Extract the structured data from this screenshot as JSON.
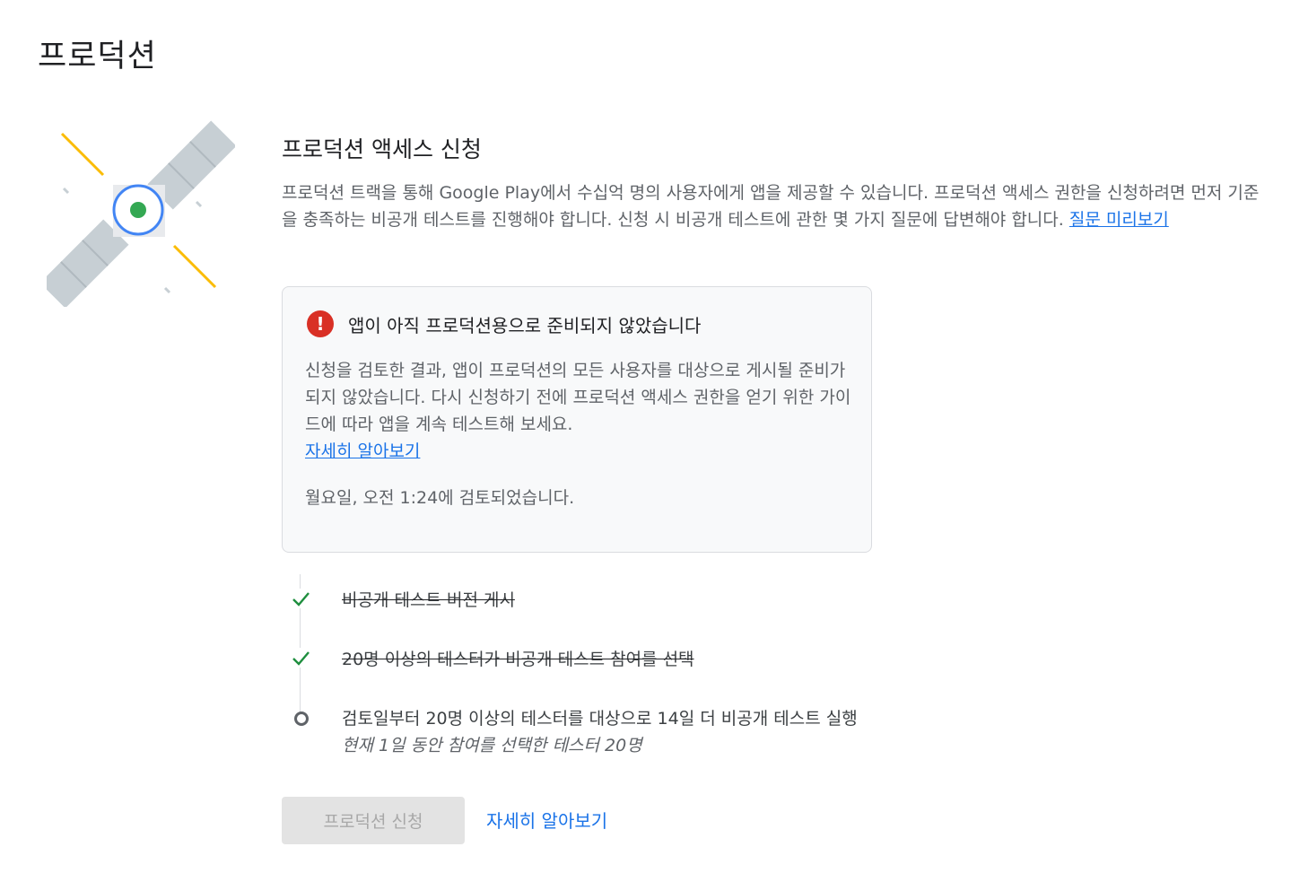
{
  "page": {
    "title": "프로덕션"
  },
  "section": {
    "title": "프로덕션 액세스 신청",
    "description": "프로덕션 트랙을 통해 Google Play에서 수십억 명의 사용자에게 앱을 제공할 수 있습니다. 프로덕션 액세스 권한을 신청하려면 먼저 기준을 충족하는 비공개 테스트를 진행해야 합니다. 신청 시 비공개 테스트에 관한 몇 가지 질문에 답변해야 합니다. ",
    "preview_link": "질문 미리보기"
  },
  "alert": {
    "icon": "error-icon",
    "icon_glyph": "!",
    "title": "앱이 아직 프로덕션용으로 준비되지 않았습니다",
    "body": "신청을 검토한 결과, 앱이 프로덕션의 모든 사용자를 대상으로 게시될 준비가 되지 않았습니다. 다시 신청하기 전에 프로덕션 액세스 권한을 얻기 위한 가이드에 따라 앱을 계속 테스트해 보세요.",
    "learn_more_link": "자세히 알아보기",
    "reviewed": "월요일, 오전 1:24에 검토되었습니다."
  },
  "steps": [
    {
      "label": "비공개 테스트 버전 게시",
      "status": "done"
    },
    {
      "label": "20명 이상의 테스터가 비공개 테스트 참여를 선택",
      "status": "done"
    },
    {
      "label": "검토일부터 20명 이상의 테스터를 대상으로 14일 더 비공개 테스트 실행",
      "sub": "현재 1일 동안 참여를 선택한 테스터 20명",
      "status": "pending"
    }
  ],
  "actions": {
    "apply_label": "프로덕션 신청",
    "learn_more_label": "자세히 알아보기"
  },
  "colors": {
    "accent": "#1a73e8",
    "error": "#d93025",
    "success": "#1e8e3e",
    "satellite_ring": "#4285f4",
    "satellite_core": "#34a853",
    "beam": "#fbbc04",
    "panel": "#c7cfd4"
  }
}
